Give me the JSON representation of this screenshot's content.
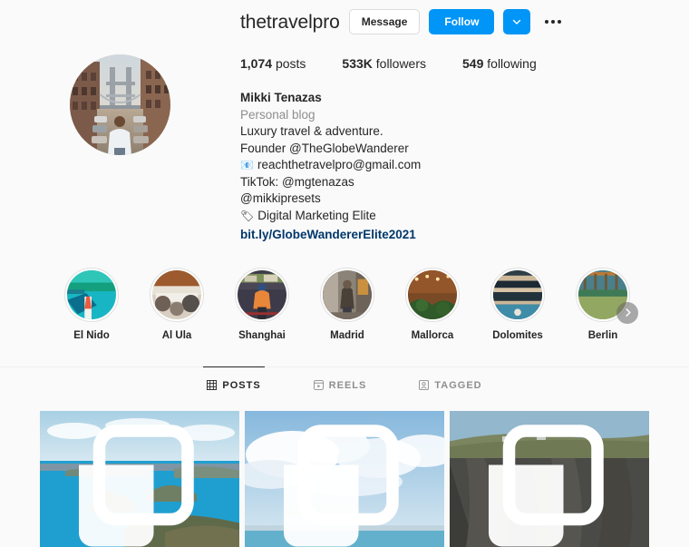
{
  "profile": {
    "username": "thetravelpro",
    "full_name": "Mikki Tenazas",
    "category": "Personal blog",
    "avatar_alt": "profile-photo"
  },
  "actions": {
    "message_label": "Message",
    "follow_label": "Follow",
    "dropdown_icon": "chevron-down-icon",
    "more_icon": "more-options-icon"
  },
  "stats": [
    {
      "value": "1,074",
      "label": "posts"
    },
    {
      "value": "533K",
      "label": "followers"
    },
    {
      "value": "549",
      "label": "following"
    }
  ],
  "bio": {
    "lines": [
      "Luxury travel & adventure.",
      "Founder @TheGlobeWanderer"
    ],
    "email": "reachthetravelpro@gmail.com",
    "email_icon": "📧",
    "tiktok": "TikTok: @mgtenazas",
    "secondary_handle": "@mikkipresets",
    "tag_icon": "🏷",
    "tag_text": "Digital Marketing Elite",
    "link": "bit.ly/GlobeWandererElite2021"
  },
  "highlights": [
    {
      "label": "El Nido",
      "theme": "elnido"
    },
    {
      "label": "Al Ula",
      "theme": "alula"
    },
    {
      "label": "Shanghai",
      "theme": "shanghai"
    },
    {
      "label": "Madrid",
      "theme": "madrid"
    },
    {
      "label": "Mallorca",
      "theme": "mallorca"
    },
    {
      "label": "Dolomites",
      "theme": "dolomites"
    },
    {
      "label": "Berlin",
      "theme": "berlin"
    }
  ],
  "highlights_next_icon": "chevron-right-icon",
  "tabs": [
    {
      "label": "POSTS",
      "icon": "grid-icon",
      "active": true
    },
    {
      "label": "REELS",
      "icon": "reels-icon",
      "active": false
    },
    {
      "label": "TAGGED",
      "icon": "tagged-icon",
      "active": false
    }
  ],
  "posts": [
    {
      "alt": "islands-seascape",
      "badge": "carousel-icon"
    },
    {
      "alt": "clouds-over-ocean",
      "badge": "carousel-icon"
    },
    {
      "alt": "coastal-cliffs",
      "badge": "carousel-icon"
    }
  ],
  "colors": {
    "accent": "#0095f6",
    "link": "#00376b",
    "text": "#262626",
    "muted": "#8e8e8e",
    "background": "#fafafa",
    "border": "#dbdbdb"
  }
}
